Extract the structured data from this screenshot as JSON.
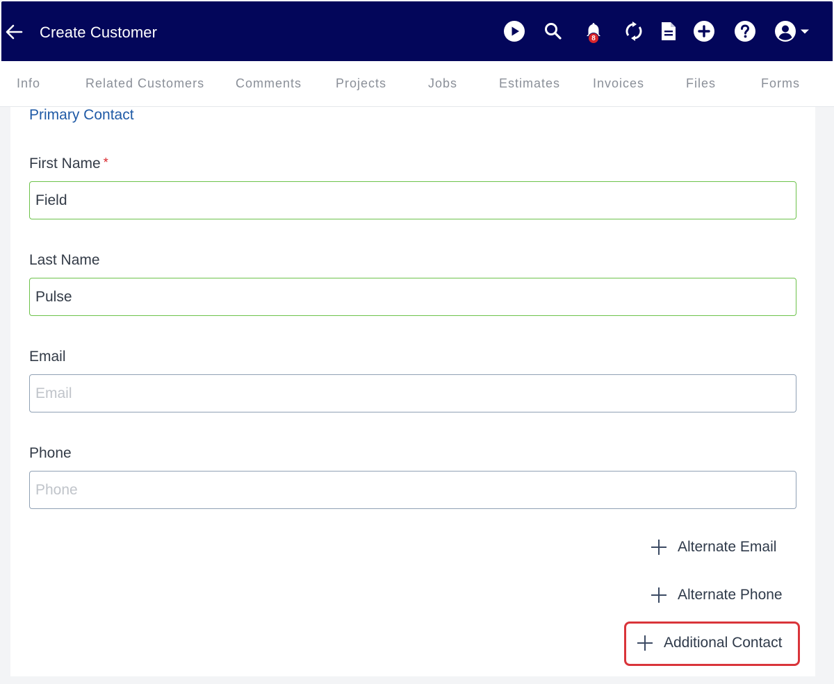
{
  "header": {
    "title": "Create Customer",
    "notification_count": "8",
    "icons": [
      "arrow-left-icon",
      "play-icon",
      "search-icon",
      "bell-icon",
      "sync-icon",
      "document-icon",
      "plus-circle-icon",
      "help-icon",
      "user-menu-icon"
    ],
    "background": "#03065a"
  },
  "tabs": [
    {
      "label": "Info"
    },
    {
      "label": "Related Customers"
    },
    {
      "label": "Comments"
    },
    {
      "label": "Projects"
    },
    {
      "label": "Jobs"
    },
    {
      "label": "Estimates"
    },
    {
      "label": "Invoices"
    },
    {
      "label": "Files"
    },
    {
      "label": "Forms"
    }
  ],
  "form": {
    "section_title": "Primary Contact",
    "first_name": {
      "label": "First Name",
      "required_mark": "*",
      "value": "Field"
    },
    "last_name": {
      "label": "Last Name",
      "value": "Pulse"
    },
    "email": {
      "label": "Email",
      "placeholder": "Email",
      "value": ""
    },
    "phone": {
      "label": "Phone",
      "placeholder": "Phone",
      "value": ""
    }
  },
  "actions": {
    "alternate_email": "Alternate Email",
    "alternate_phone": "Alternate Phone",
    "additional_contact": "Additional Contact"
  },
  "colors": {
    "accent": "#1f5aa6",
    "valid_border": "#6cc24a",
    "highlight": "#d9343a",
    "badge": "#d9252b"
  }
}
